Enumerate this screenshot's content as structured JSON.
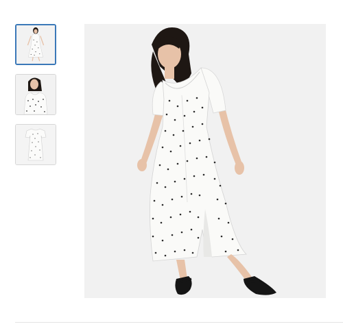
{
  "gallery": {
    "thumbnails": [
      {
        "view": "full-length-front",
        "selected": true
      },
      {
        "view": "close-up-upper",
        "selected": false
      },
      {
        "view": "flat-lay-dress",
        "selected": false
      }
    ],
    "main_view": "full-length-front"
  },
  "colors": {
    "selected_border": "#3a78b8",
    "thumb_border": "#d6d6d6",
    "image_bg": "#f1f1f1",
    "dress": "#f7f7f5",
    "dots": "#2b2b2b",
    "hair": "#1e1713",
    "skin": "#e7c2a8",
    "sandal": "#151515"
  }
}
